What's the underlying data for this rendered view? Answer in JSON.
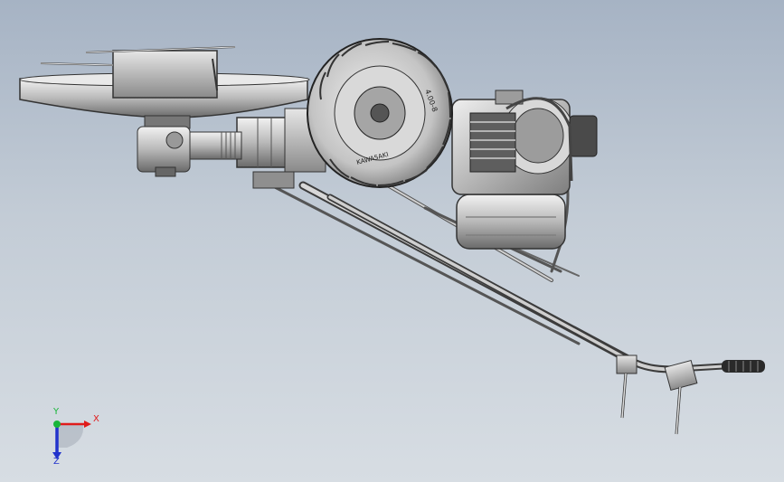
{
  "viewport": {
    "background_top": "#a6b3c4",
    "background_bottom": "#d7dde3"
  },
  "model": {
    "parts": [
      "spreader-hopper",
      "hopper-lid",
      "gearbox",
      "drive-shaft",
      "tire",
      "engine",
      "fuel-tank",
      "handlebar-frame",
      "handle-grip"
    ],
    "tire_marking": "4.00-8",
    "tire_sidewall": "KAWASAKI"
  },
  "triad": {
    "x_label": "X",
    "y_label": "Y",
    "z_label": "Z",
    "x_color": "#e01b1b",
    "y_color": "#19b53a",
    "z_color": "#2233cc"
  }
}
